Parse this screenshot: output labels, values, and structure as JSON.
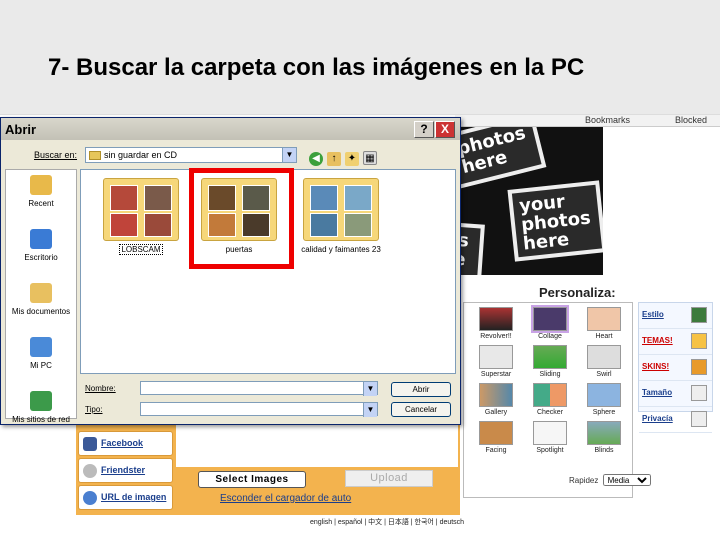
{
  "slide": {
    "title": "7- Buscar la carpeta con las imágenes en la PC"
  },
  "browser": {
    "items": [
      "Bookmarks",
      "Blocked"
    ]
  },
  "collage": {
    "texts": [
      "photos here",
      "your photos here",
      "os re"
    ]
  },
  "dialog": {
    "title": "Abrir",
    "help": "?",
    "close": "X",
    "look_in_label": "Buscar en:",
    "look_in_value": "sin guardar en CD",
    "places": [
      {
        "label": "Recent",
        "icon": "recent-folder-icon",
        "color": "#e8b94a"
      },
      {
        "label": "Escritorio",
        "icon": "desktop-icon",
        "color": "#3a7bd5"
      },
      {
        "label": "Mis documentos",
        "icon": "my-documents-icon",
        "color": "#e8c060"
      },
      {
        "label": "Mi PC",
        "icon": "my-computer-icon",
        "color": "#4a8ad8"
      },
      {
        "label": "Mis sitios de red",
        "icon": "network-places-icon",
        "color": "#3c9a4a"
      }
    ],
    "files": [
      {
        "name": "LOBSCAM"
      },
      {
        "name": "puertas"
      },
      {
        "name": "calidad y faimantes 23"
      }
    ],
    "filename_label": "Nombre:",
    "filetype_label": "Tipo:",
    "open_button": "Abrir",
    "cancel_button": "Cancelar"
  },
  "sidebar": {
    "links": [
      {
        "label": "Facebook",
        "color": "#3b5998"
      },
      {
        "label": "Friendster",
        "color": "#999999"
      },
      {
        "label": "URL de imagen",
        "color": "#4a7fd0"
      }
    ]
  },
  "upload": {
    "select_button": "Select Images",
    "upload_button": "Upload",
    "loader_link": "Esconder el cargador de auto"
  },
  "languages": "english | español | 中文 | 日本語 | 한국어 | deutsch",
  "personaliza": {
    "title": "Personaliza:",
    "styles": [
      "Revolver!!",
      "Collage",
      "Heart",
      "Superstar",
      "Sliding",
      "Swirl",
      "Gallery",
      "Checker",
      "Sphere",
      "Facing",
      "Spotlight",
      "Blinds"
    ],
    "options": [
      "Estilo",
      "TEMAS!",
      "SKINS!",
      "Tamaño",
      "Privacía"
    ],
    "rapidez_label": "Rapidez",
    "rapidez_value": "Media"
  }
}
